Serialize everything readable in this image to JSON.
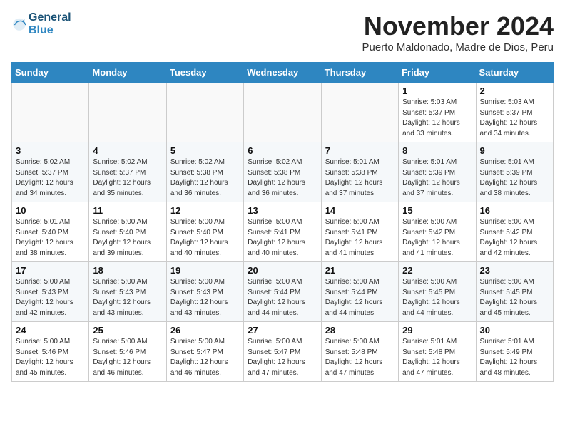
{
  "header": {
    "logo_line1": "General",
    "logo_line2": "Blue",
    "month_title": "November 2024",
    "subtitle": "Puerto Maldonado, Madre de Dios, Peru"
  },
  "days_of_week": [
    "Sunday",
    "Monday",
    "Tuesday",
    "Wednesday",
    "Thursday",
    "Friday",
    "Saturday"
  ],
  "weeks": [
    [
      {
        "day": "",
        "info": ""
      },
      {
        "day": "",
        "info": ""
      },
      {
        "day": "",
        "info": ""
      },
      {
        "day": "",
        "info": ""
      },
      {
        "day": "",
        "info": ""
      },
      {
        "day": "1",
        "info": "Sunrise: 5:03 AM\nSunset: 5:37 PM\nDaylight: 12 hours\nand 33 minutes."
      },
      {
        "day": "2",
        "info": "Sunrise: 5:03 AM\nSunset: 5:37 PM\nDaylight: 12 hours\nand 34 minutes."
      }
    ],
    [
      {
        "day": "3",
        "info": "Sunrise: 5:02 AM\nSunset: 5:37 PM\nDaylight: 12 hours\nand 34 minutes."
      },
      {
        "day": "4",
        "info": "Sunrise: 5:02 AM\nSunset: 5:37 PM\nDaylight: 12 hours\nand 35 minutes."
      },
      {
        "day": "5",
        "info": "Sunrise: 5:02 AM\nSunset: 5:38 PM\nDaylight: 12 hours\nand 36 minutes."
      },
      {
        "day": "6",
        "info": "Sunrise: 5:02 AM\nSunset: 5:38 PM\nDaylight: 12 hours\nand 36 minutes."
      },
      {
        "day": "7",
        "info": "Sunrise: 5:01 AM\nSunset: 5:38 PM\nDaylight: 12 hours\nand 37 minutes."
      },
      {
        "day": "8",
        "info": "Sunrise: 5:01 AM\nSunset: 5:39 PM\nDaylight: 12 hours\nand 37 minutes."
      },
      {
        "day": "9",
        "info": "Sunrise: 5:01 AM\nSunset: 5:39 PM\nDaylight: 12 hours\nand 38 minutes."
      }
    ],
    [
      {
        "day": "10",
        "info": "Sunrise: 5:01 AM\nSunset: 5:40 PM\nDaylight: 12 hours\nand 38 minutes."
      },
      {
        "day": "11",
        "info": "Sunrise: 5:00 AM\nSunset: 5:40 PM\nDaylight: 12 hours\nand 39 minutes."
      },
      {
        "day": "12",
        "info": "Sunrise: 5:00 AM\nSunset: 5:40 PM\nDaylight: 12 hours\nand 40 minutes."
      },
      {
        "day": "13",
        "info": "Sunrise: 5:00 AM\nSunset: 5:41 PM\nDaylight: 12 hours\nand 40 minutes."
      },
      {
        "day": "14",
        "info": "Sunrise: 5:00 AM\nSunset: 5:41 PM\nDaylight: 12 hours\nand 41 minutes."
      },
      {
        "day": "15",
        "info": "Sunrise: 5:00 AM\nSunset: 5:42 PM\nDaylight: 12 hours\nand 41 minutes."
      },
      {
        "day": "16",
        "info": "Sunrise: 5:00 AM\nSunset: 5:42 PM\nDaylight: 12 hours\nand 42 minutes."
      }
    ],
    [
      {
        "day": "17",
        "info": "Sunrise: 5:00 AM\nSunset: 5:43 PM\nDaylight: 12 hours\nand 42 minutes."
      },
      {
        "day": "18",
        "info": "Sunrise: 5:00 AM\nSunset: 5:43 PM\nDaylight: 12 hours\nand 43 minutes."
      },
      {
        "day": "19",
        "info": "Sunrise: 5:00 AM\nSunset: 5:43 PM\nDaylight: 12 hours\nand 43 minutes."
      },
      {
        "day": "20",
        "info": "Sunrise: 5:00 AM\nSunset: 5:44 PM\nDaylight: 12 hours\nand 44 minutes."
      },
      {
        "day": "21",
        "info": "Sunrise: 5:00 AM\nSunset: 5:44 PM\nDaylight: 12 hours\nand 44 minutes."
      },
      {
        "day": "22",
        "info": "Sunrise: 5:00 AM\nSunset: 5:45 PM\nDaylight: 12 hours\nand 44 minutes."
      },
      {
        "day": "23",
        "info": "Sunrise: 5:00 AM\nSunset: 5:45 PM\nDaylight: 12 hours\nand 45 minutes."
      }
    ],
    [
      {
        "day": "24",
        "info": "Sunrise: 5:00 AM\nSunset: 5:46 PM\nDaylight: 12 hours\nand 45 minutes."
      },
      {
        "day": "25",
        "info": "Sunrise: 5:00 AM\nSunset: 5:46 PM\nDaylight: 12 hours\nand 46 minutes."
      },
      {
        "day": "26",
        "info": "Sunrise: 5:00 AM\nSunset: 5:47 PM\nDaylight: 12 hours\nand 46 minutes."
      },
      {
        "day": "27",
        "info": "Sunrise: 5:00 AM\nSunset: 5:47 PM\nDaylight: 12 hours\nand 47 minutes."
      },
      {
        "day": "28",
        "info": "Sunrise: 5:00 AM\nSunset: 5:48 PM\nDaylight: 12 hours\nand 47 minutes."
      },
      {
        "day": "29",
        "info": "Sunrise: 5:01 AM\nSunset: 5:48 PM\nDaylight: 12 hours\nand 47 minutes."
      },
      {
        "day": "30",
        "info": "Sunrise: 5:01 AM\nSunset: 5:49 PM\nDaylight: 12 hours\nand 48 minutes."
      }
    ]
  ]
}
